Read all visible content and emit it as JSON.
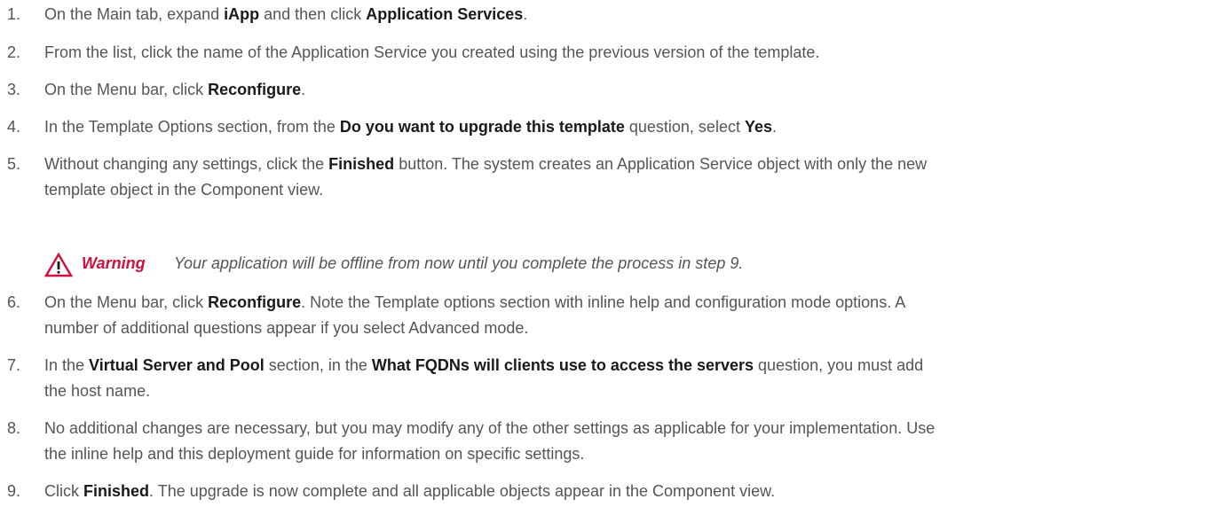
{
  "steps": [
    {
      "number": "1.",
      "lines": [
        [
          {
            "text": "On the Main tab, expand ",
            "bold": false
          },
          {
            "text": "iApp",
            "bold": true
          },
          {
            "text": " and then click ",
            "bold": false
          },
          {
            "text": "Application Services",
            "bold": true
          },
          {
            "text": ".",
            "bold": false
          }
        ]
      ]
    },
    {
      "number": "2.",
      "lines": [
        [
          {
            "text": "From the list, click the name of the Application Service you created using the previous version of the template.",
            "bold": false
          }
        ]
      ]
    },
    {
      "number": "3.",
      "lines": [
        [
          {
            "text": "On the Menu bar, click ",
            "bold": false
          },
          {
            "text": "Reconfigure",
            "bold": true
          },
          {
            "text": ".",
            "bold": false
          }
        ]
      ]
    },
    {
      "number": "4.",
      "lines": [
        [
          {
            "text": "In the Template Options section, from the ",
            "bold": false
          },
          {
            "text": "Do you want to upgrade this template",
            "bold": true
          },
          {
            "text": " question, select ",
            "bold": false
          },
          {
            "text": "Yes",
            "bold": true
          },
          {
            "text": ".",
            "bold": false
          }
        ]
      ]
    },
    {
      "number": "5.",
      "lines": [
        [
          {
            "text": "Without changing any settings, click the ",
            "bold": false
          },
          {
            "text": "Finished",
            "bold": true
          },
          {
            "text": " button.  The system creates an Application Service object with only the new",
            "bold": false
          }
        ],
        [
          {
            "text": "template object in the Component view.",
            "bold": false
          }
        ]
      ]
    },
    {
      "number": "6.",
      "lines": [
        [
          {
            "text": "On the Menu bar, click ",
            "bold": false
          },
          {
            "text": "Reconfigure",
            "bold": true
          },
          {
            "text": ".  Note the Template options section with inline help and configuration mode options.  A",
            "bold": false
          }
        ],
        [
          {
            "text": "number of additional questions appear if you select Advanced mode.",
            "bold": false
          }
        ]
      ]
    },
    {
      "number": "7.",
      "lines": [
        [
          {
            "text": "In the ",
            "bold": false
          },
          {
            "text": "Virtual Server and Pool",
            "bold": true
          },
          {
            "text": " section, in the ",
            "bold": false
          },
          {
            "text": "What FQDNs will clients use to access the servers",
            "bold": true
          },
          {
            "text": " question, you must add",
            "bold": false
          }
        ],
        [
          {
            "text": "the host name.",
            "bold": false
          }
        ]
      ]
    },
    {
      "number": "8.",
      "lines": [
        [
          {
            "text": "No additional changes are necessary, but you may modify any of the other settings as applicable for your implementation.  Use",
            "bold": false
          }
        ],
        [
          {
            "text": "the inline help and this deployment guide for information on specific settings.",
            "bold": false
          }
        ]
      ]
    },
    {
      "number": "9.",
      "lines": [
        [
          {
            "text": "Click ",
            "bold": false
          },
          {
            "text": "Finished",
            "bold": true
          },
          {
            "text": ".  The upgrade is now complete and all applicable objects appear in the Component view.",
            "bold": false
          }
        ]
      ]
    }
  ],
  "warning": {
    "icon": "warning-triangle-icon",
    "label": "Warning",
    "text": "Your application will be offline from now until you complete the process in step 9."
  },
  "colors": {
    "body_text": "#555555",
    "bold_text": "#1a1a1a",
    "warning_accent": "#d0103a"
  }
}
